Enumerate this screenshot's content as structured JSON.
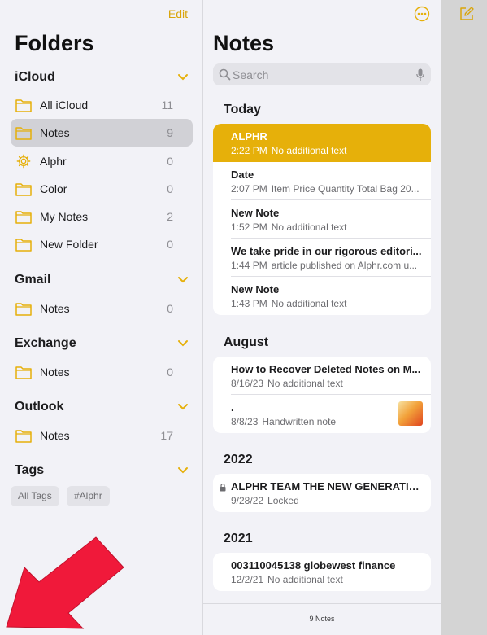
{
  "folders_pane": {
    "edit_label": "Edit",
    "title": "Folders",
    "sections": [
      {
        "name": "iCloud",
        "items": [
          {
            "label": "All iCloud",
            "count": "11",
            "icon": "folder-icon"
          },
          {
            "label": "Notes",
            "count": "9",
            "icon": "folder-icon",
            "selected": true
          },
          {
            "label": "Alphr",
            "count": "0",
            "icon": "gear-icon"
          },
          {
            "label": "Color",
            "count": "0",
            "icon": "folder-icon"
          },
          {
            "label": "My Notes",
            "count": "2",
            "icon": "folder-icon"
          },
          {
            "label": "New Folder",
            "count": "0",
            "icon": "folder-icon"
          }
        ]
      },
      {
        "name": "Gmail",
        "items": [
          {
            "label": "Notes",
            "count": "0",
            "icon": "folder-icon"
          }
        ]
      },
      {
        "name": "Exchange",
        "items": [
          {
            "label": "Notes",
            "count": "0",
            "icon": "folder-icon"
          }
        ]
      },
      {
        "name": "Outlook",
        "items": [
          {
            "label": "Notes",
            "count": "17",
            "icon": "folder-icon"
          }
        ]
      }
    ],
    "tags_header": "Tags",
    "tags": [
      "All Tags",
      "#Alphr"
    ]
  },
  "notes_pane": {
    "title": "Notes",
    "search_placeholder": "Search",
    "groups": [
      {
        "title": "Today",
        "notes": [
          {
            "title": "ALPHR",
            "time": "2:22 PM",
            "preview": "No additional text",
            "selected": true
          },
          {
            "title": "Date",
            "time": "2:07 PM",
            "preview": "Item Price Quantity Total Bag 20..."
          },
          {
            "title": "New Note",
            "time": "1:52 PM",
            "preview": "No additional text"
          },
          {
            "title": "We take pride in our rigorous editori...",
            "time": "1:44 PM",
            "preview": "article published on Alphr.com u..."
          },
          {
            "title": "New Note",
            "time": "1:43 PM",
            "preview": "No additional text"
          }
        ]
      },
      {
        "title": "August",
        "notes": [
          {
            "title": "How to Recover Deleted Notes on M...",
            "time": "8/16/23",
            "preview": "No additional text"
          },
          {
            "title": ".",
            "time": "8/8/23",
            "preview": "Handwritten note",
            "thumbnail": true
          }
        ]
      },
      {
        "title": "2022",
        "notes": [
          {
            "title": "ALPHR TEAM THE NEW GENERATIO...",
            "time": "9/28/22",
            "preview": "Locked",
            "locked": true
          }
        ]
      },
      {
        "title": "2021",
        "notes": [
          {
            "title": "003110045138 globewest finance",
            "time": "12/2/21",
            "preview": "No additional text"
          }
        ]
      }
    ],
    "footer_count": "9 Notes"
  },
  "colors": {
    "accent": "#e6b00a",
    "arrow": "#f0193a"
  }
}
